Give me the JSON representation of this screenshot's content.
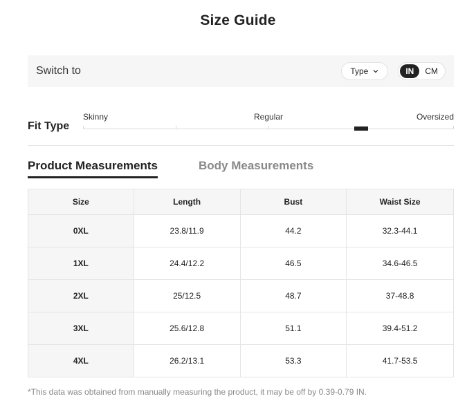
{
  "page_title": "Size Guide",
  "switch_bar": {
    "label": "Switch to",
    "type_select": "Type",
    "units": [
      {
        "label": "IN",
        "active": true
      },
      {
        "label": "CM",
        "active": false
      }
    ]
  },
  "fit": {
    "label": "Fit Type",
    "scale": [
      "Skinny",
      "Regular",
      "Oversized"
    ],
    "level_fraction": 0.75
  },
  "tabs": [
    {
      "label": "Product Measurements",
      "active": true
    },
    {
      "label": "Body Measurements",
      "active": false
    }
  ],
  "table": {
    "headers": [
      "Size",
      "Length",
      "Bust",
      "Waist Size"
    ],
    "rows": [
      [
        "0XL",
        "23.8/11.9",
        "44.2",
        "32.3-44.1"
      ],
      [
        "1XL",
        "24.4/12.2",
        "46.5",
        "34.6-46.5"
      ],
      [
        "2XL",
        "25/12.5",
        "48.7",
        "37-48.8"
      ],
      [
        "3XL",
        "25.6/12.8",
        "51.1",
        "39.4-51.2"
      ],
      [
        "4XL",
        "26.2/13.1",
        "53.3",
        "41.7-53.5"
      ]
    ]
  },
  "footnote": "*This data was obtained from manually measuring the product, it may be off by 0.39-0.79 IN.",
  "colors": {
    "accent": "#222222",
    "panel": "#f6f6f6",
    "muted": "#888888"
  }
}
